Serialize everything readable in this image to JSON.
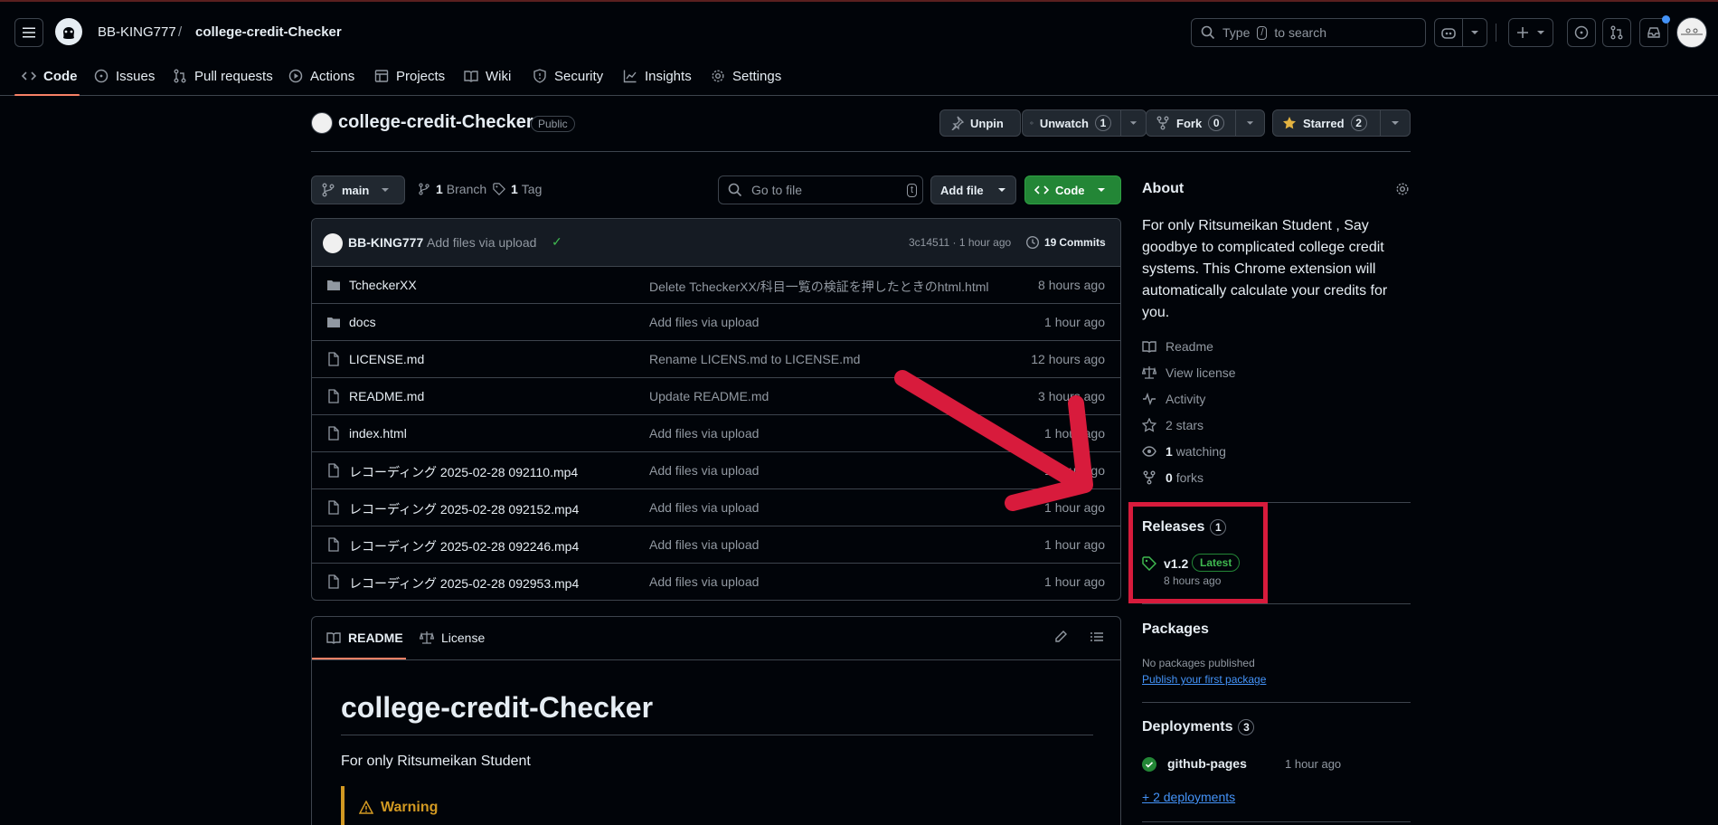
{
  "header": {
    "owner": "BB-KING777",
    "separator": "/",
    "repo": "college-credit-Checker",
    "search_prefix": "Type",
    "search_key": "/",
    "search_suffix": "to search"
  },
  "nav": {
    "tabs": [
      {
        "label": "Code"
      },
      {
        "label": "Issues"
      },
      {
        "label": "Pull requests"
      },
      {
        "label": "Actions"
      },
      {
        "label": "Projects"
      },
      {
        "label": "Wiki"
      },
      {
        "label": "Security"
      },
      {
        "label": "Insights"
      },
      {
        "label": "Settings"
      }
    ]
  },
  "repo": {
    "name": "college-credit-Checker",
    "visibility": "Public",
    "unpin_label": "Unpin",
    "unwatch_label": "Unwatch",
    "watch_count": "1",
    "fork_label": "Fork",
    "fork_count": "0",
    "starred_label": "Starred",
    "star_count": "2"
  },
  "toolbar": {
    "branch": "main",
    "branch_count": "1",
    "branch_label": "Branch",
    "tag_count": "1",
    "tag_label": "Tag",
    "go_to_file": "Go to file",
    "go_to_file_key": "t",
    "add_file": "Add file",
    "code": "Code"
  },
  "commit": {
    "author": "BB-KING777",
    "message": "Add files via upload",
    "check": "✓",
    "hash_time": "3c14511 · 1 hour ago",
    "commits_count": "19",
    "commits_label": "Commits"
  },
  "files": [
    {
      "type": "dir",
      "name": "TcheckerXX",
      "message": "Delete TcheckerXX/科目一覧の検証を押したときのhtml.html",
      "time": "8 hours ago"
    },
    {
      "type": "dir",
      "name": "docs",
      "message": "Add files via upload",
      "time": "1 hour ago"
    },
    {
      "type": "file",
      "name": "LICENSE.md",
      "message": "Rename LICENS.md to LICENSE.md",
      "time": "12 hours ago"
    },
    {
      "type": "file",
      "name": "README.md",
      "message": "Update README.md",
      "time": "3 hours ago"
    },
    {
      "type": "file",
      "name": "index.html",
      "message": "Add files via upload",
      "time": "1 hour ago"
    },
    {
      "type": "file",
      "name": "レコーディング 2025-02-28 092110.mp4",
      "message": "Add files via upload",
      "time": "1 hour ago"
    },
    {
      "type": "file",
      "name": "レコーディング 2025-02-28 092152.mp4",
      "message": "Add files via upload",
      "time": "1 hour ago"
    },
    {
      "type": "file",
      "name": "レコーディング 2025-02-28 092246.mp4",
      "message": "Add files via upload",
      "time": "1 hour ago"
    },
    {
      "type": "file",
      "name": "レコーディング 2025-02-28 092953.mp4",
      "message": "Add files via upload",
      "time": "1 hour ago"
    }
  ],
  "readme": {
    "tab_readme": "README",
    "tab_license": "License",
    "heading": "college-credit-Checker",
    "intro": "For only Ritsumeikan Student",
    "warning": "Warning"
  },
  "about": {
    "title": "About",
    "description": "For only Ritsumeikan Student , Say goodbye to complicated college credit systems. This Chrome extension will automatically calculate your credits for you.",
    "readme": "Readme",
    "license": "View license",
    "activity": "Activity",
    "stars": "2 stars",
    "watching_count": "1",
    "watching_label": "watching",
    "forks_count": "0",
    "forks_label": "forks"
  },
  "releases": {
    "title": "Releases",
    "count": "1",
    "version": "v1.2",
    "latest": "Latest",
    "time": "8 hours ago"
  },
  "packages": {
    "title": "Packages",
    "none": "No packages published",
    "publish_link": "Publish your first package"
  },
  "deployments": {
    "title": "Deployments",
    "count": "3",
    "env": "github-pages",
    "env_time": "1 hour ago",
    "more": "+ 2 deployments"
  },
  "colors": {
    "accent_green": "#238636",
    "annotation_red": "#d81b3c",
    "link_blue": "#4493f8",
    "warning_orange": "#d29922"
  }
}
